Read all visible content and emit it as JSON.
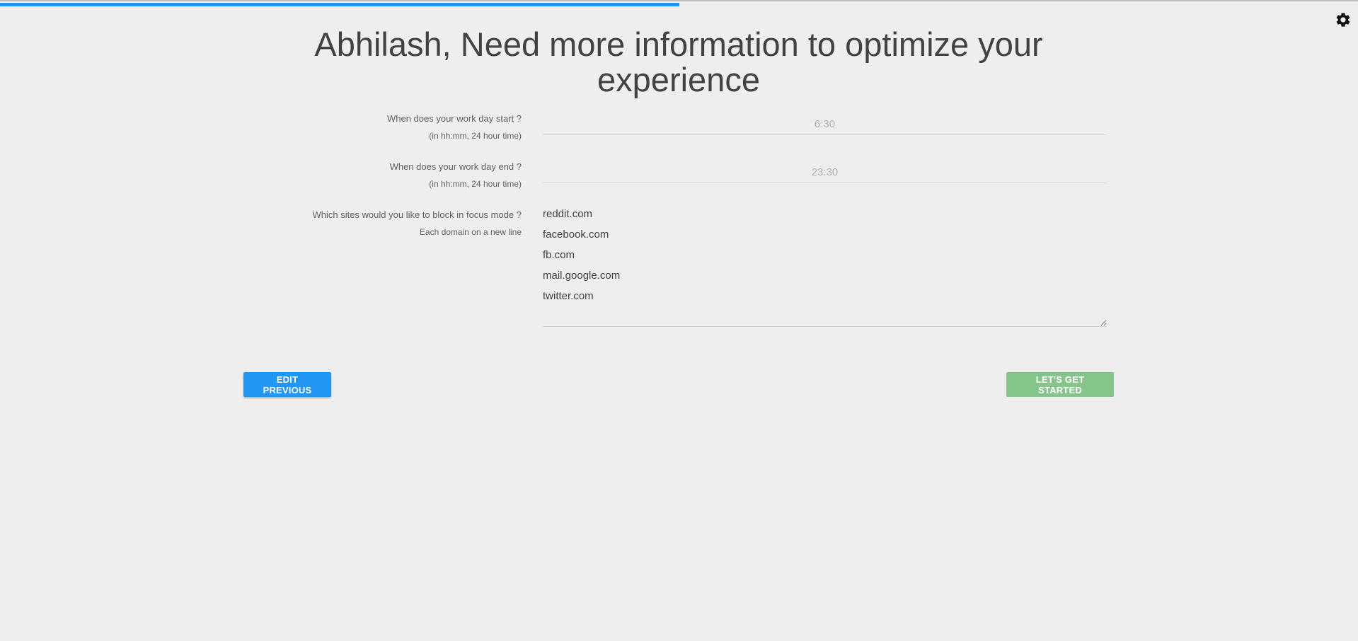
{
  "progress": {
    "fraction": 0.5
  },
  "settings": {
    "icon": "gear-icon"
  },
  "title": "Abhilash, Need more information to optimize your experience",
  "fields": {
    "start": {
      "label": "When does your work day start ?",
      "hint": "(in hh:mm, 24 hour time)",
      "placeholder": "6:30"
    },
    "end": {
      "label": "When does your work day end ?",
      "hint": "(in hh:mm, 24 hour time)",
      "placeholder": "23:30"
    },
    "sites": {
      "label": "Which sites would you like to block in focus mode ?",
      "hint": "Each domain on a new line",
      "value": "reddit.com\nfacebook.com\nfb.com\nmail.google.com\ntwitter.com"
    }
  },
  "buttons": {
    "previous": "EDIT PREVIOUS",
    "start": "LET'S GET STARTED"
  },
  "colors": {
    "primary": "#2196f3",
    "success_disabled": "#86c58a",
    "background": "#eeeeee"
  }
}
